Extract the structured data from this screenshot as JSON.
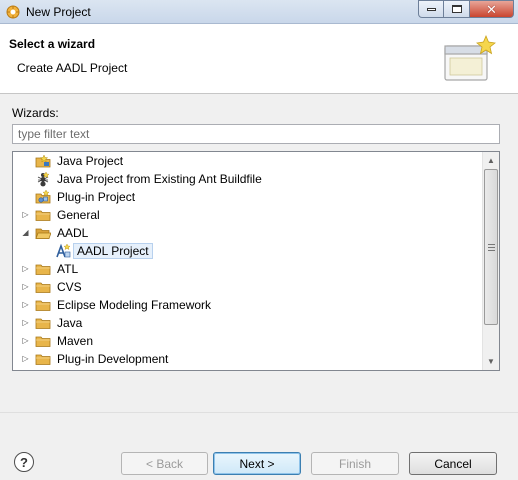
{
  "window": {
    "title": "New Project"
  },
  "banner": {
    "title": "Select a wizard",
    "description": "Create AADL Project"
  },
  "wizards": {
    "label": "Wizards:",
    "filter_placeholder": "type filter text",
    "filter_value": ""
  },
  "tree": {
    "items": [
      {
        "label": "Java Project",
        "icon": "java-project-icon",
        "level": 1,
        "expander": "none"
      },
      {
        "label": "Java Project from Existing Ant Buildfile",
        "icon": "ant-buildfile-icon",
        "level": 1,
        "expander": "none"
      },
      {
        "label": "Plug-in Project",
        "icon": "plugin-project-icon",
        "level": 1,
        "expander": "none"
      },
      {
        "label": "General",
        "icon": "folder-icon",
        "level": 1,
        "expander": "collapsed"
      },
      {
        "label": "AADL",
        "icon": "folder-icon",
        "level": 1,
        "expander": "expanded"
      },
      {
        "label": "AADL Project",
        "icon": "aadl-project-icon",
        "level": 2,
        "expander": "none",
        "selected": true
      },
      {
        "label": "ATL",
        "icon": "folder-icon",
        "level": 1,
        "expander": "collapsed"
      },
      {
        "label": "CVS",
        "icon": "folder-icon",
        "level": 1,
        "expander": "collapsed"
      },
      {
        "label": "Eclipse Modeling Framework",
        "icon": "folder-icon",
        "level": 1,
        "expander": "collapsed"
      },
      {
        "label": "Java",
        "icon": "folder-icon",
        "level": 1,
        "expander": "collapsed"
      },
      {
        "label": "Maven",
        "icon": "folder-icon",
        "level": 1,
        "expander": "collapsed"
      },
      {
        "label": "Plug-in Development",
        "icon": "folder-icon",
        "level": 1,
        "expander": "collapsed"
      }
    ]
  },
  "buttons": {
    "help": "?",
    "back": "< Back",
    "next": "Next >",
    "finish": "Finish",
    "cancel": "Cancel"
  },
  "colors": {
    "folder": "#e8b54a",
    "selection_bg": "#e6f0fb",
    "selection_border": "#b8d1ee",
    "default_button_border": "#3c7fb1"
  }
}
